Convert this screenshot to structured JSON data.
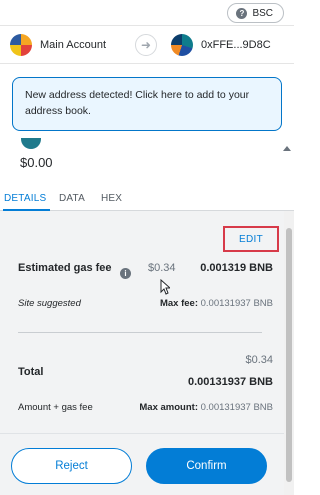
{
  "network": {
    "label": "BSC",
    "icon": "question-icon"
  },
  "from_account": {
    "name": "Main Account"
  },
  "to_account": {
    "address": "0xFFE...9D8C"
  },
  "notice": {
    "text": "New address detected! Click here to add to your address book."
  },
  "transaction": {
    "amount": "$0.00"
  },
  "tabs": [
    {
      "label": "DETAILS",
      "active": true
    },
    {
      "label": "DATA",
      "active": false
    },
    {
      "label": "HEX",
      "active": false
    }
  ],
  "gas": {
    "edit_label": "EDIT",
    "label": "Estimated gas fee",
    "fiat": "$0.34",
    "native": "0.001319 BNB",
    "site_suggested": "Site suggested",
    "max_fee_label": "Max fee:",
    "max_fee_value": "0.00131937 BNB"
  },
  "total": {
    "label": "Total",
    "fiat": "$0.34",
    "native": "0.00131937 BNB",
    "sub_label": "Amount + gas fee",
    "max_amount_label": "Max amount:",
    "max_amount_value": "0.00131937 BNB"
  },
  "buttons": {
    "reject": "Reject",
    "confirm": "Confirm"
  },
  "colors": {
    "primary": "#037dd6",
    "highlight_box": "#d73a49",
    "notice_bg": "#eaf6ff"
  }
}
